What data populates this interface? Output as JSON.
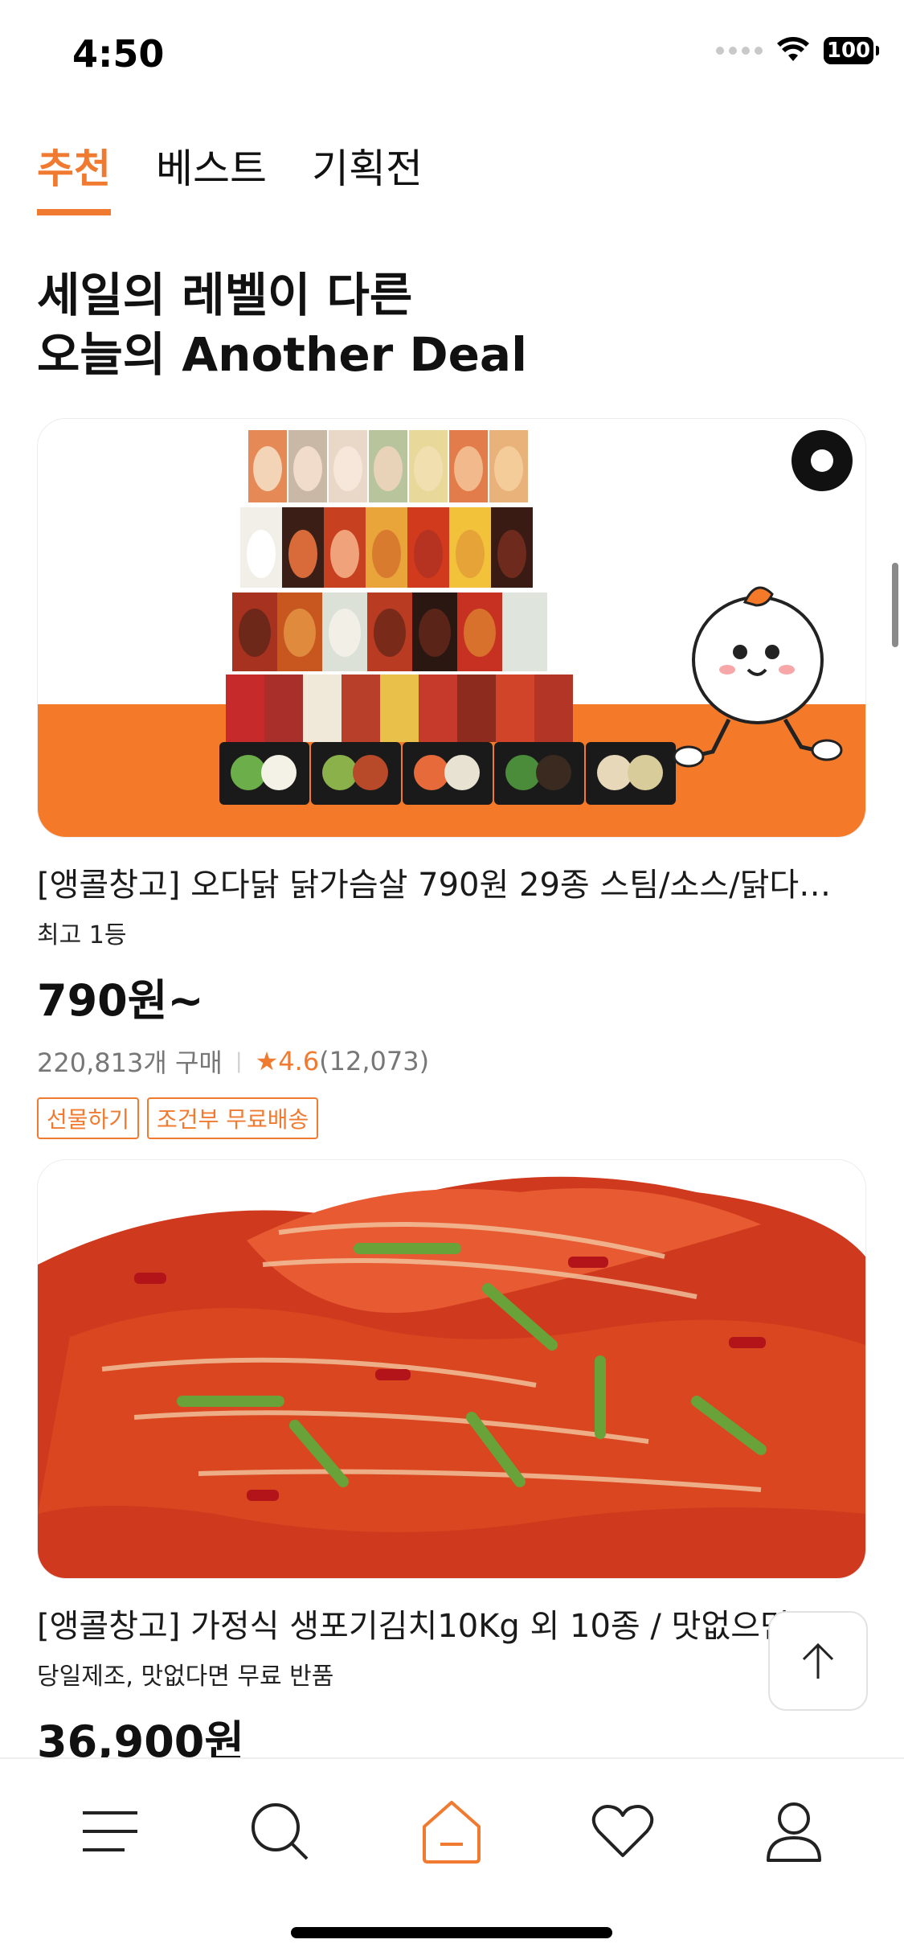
{
  "status_bar": {
    "time": "4:50",
    "battery": "100"
  },
  "tabs": [
    {
      "label": "추천",
      "active": true
    },
    {
      "label": "베스트",
      "active": false
    },
    {
      "label": "기획전",
      "active": false
    }
  ],
  "headline": {
    "line1": "세일의 레벨이 다른",
    "line2": "오늘의 Another Deal"
  },
  "products": [
    {
      "image": "chicken-breast-product-lineup-with-mascot",
      "title": "[앵콜창고] 오다닭 닭가슴살 790원 29종 스팀/소스/닭다…",
      "subtitle": "최고 1등",
      "price": "790원~",
      "purchases": "220,813개 구매",
      "star": "★",
      "rating": "4.6",
      "review_count": "(12,073)",
      "badges": [
        "선물하기",
        "조건부 무료배송"
      ]
    },
    {
      "image": "kimchi-photo",
      "title": "[앵콜창고] 가정식 생포기김치10Kg 외 10종 / 맛없으면",
      "subtitle": "당일제조, 맛없다면 무료 반품",
      "price": "36,900원"
    }
  ],
  "colors": {
    "accent": "#f07a30",
    "text": "#111111",
    "muted": "#777777"
  },
  "icons": {
    "scroll_top": "arrow-up-icon",
    "nav": [
      "menu-icon",
      "search-icon",
      "home-icon",
      "heart-icon",
      "profile-icon"
    ]
  }
}
